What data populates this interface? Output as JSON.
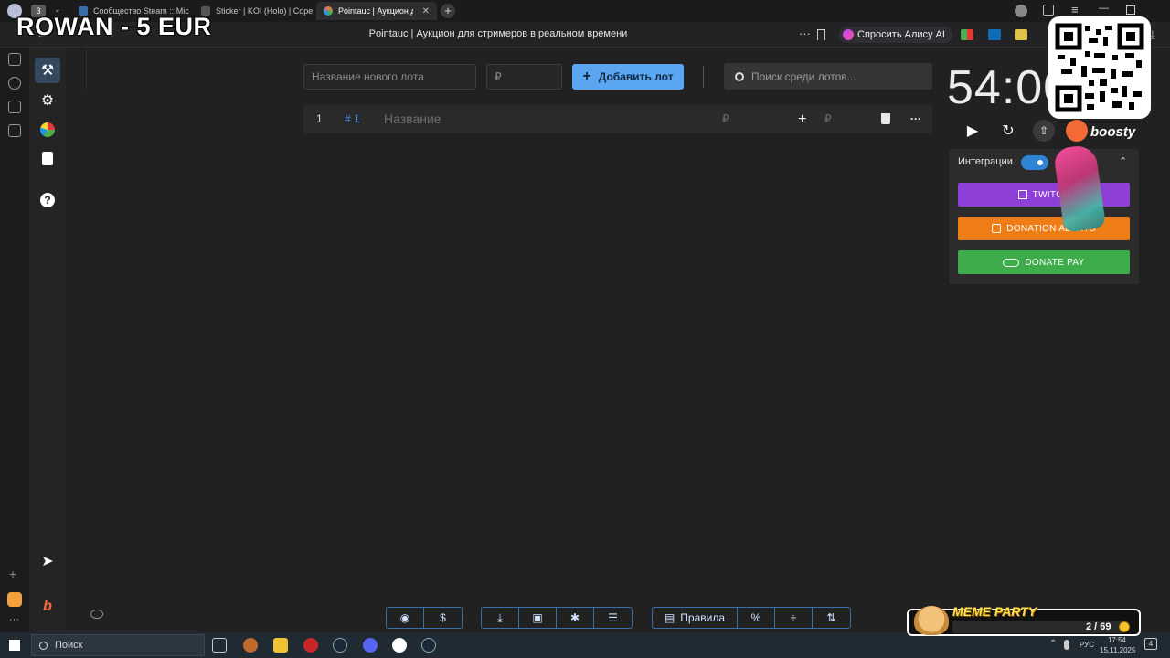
{
  "browser": {
    "tab_count": "3",
    "tabs": [
      {
        "title": "Сообщество Steam :: Mic",
        "favicon_color": "#1b2838"
      },
      {
        "title": "Sticker | KOI (Holo) | Copei",
        "favicon_color": "#333333"
      },
      {
        "title": "Pointauc | Аукцион для",
        "favicon_color": "#ff7043",
        "active": true
      }
    ],
    "page_title": "Pointauc | Аукцион для стримеров в реальном времени",
    "alisa_label": "Спросить Алису AI",
    "url_partial": "pointauc.com"
  },
  "sidebar": {
    "items": [
      {
        "icon": "gavel-icon",
        "active": true
      },
      {
        "icon": "gear-icon"
      },
      {
        "icon": "pie-chart-icon"
      },
      {
        "icon": "clipboard-icon"
      },
      {
        "icon": "help-icon"
      }
    ],
    "bottom_items": [
      {
        "icon": "telegram-icon"
      },
      {
        "icon": "boosty-icon"
      }
    ]
  },
  "lot_form": {
    "name_placeholder": "Название нового лота",
    "price_placeholder": "₽",
    "add_label": "Добавить лот",
    "search_placeholder": "Поиск среди лотов..."
  },
  "lots": [
    {
      "index": "1",
      "id": "# 1",
      "name_placeholder": "Название",
      "amount": "₽",
      "add_amount": "₽"
    }
  ],
  "timer": {
    "display": "54:00"
  },
  "integrations": {
    "label": "Интеграции",
    "enabled": true,
    "buttons": [
      {
        "label": "TWITCH",
        "color": "#8e3fd6"
      },
      {
        "label": "DONATION ALERTS",
        "color": "#ef7d16"
      },
      {
        "label": "DONATE PAY",
        "color": "#3eac4b"
      }
    ]
  },
  "bottom_toolbar": {
    "rules_label": "Правила"
  },
  "taskbar": {
    "search_label": "Поиск",
    "lang": "РУС",
    "time": "17:54",
    "date": "15.11.2025",
    "notifications": "4"
  },
  "overlays": {
    "watermark": "ROWAN - 5 EUR",
    "boosty_label": "boosty",
    "meme_title": "MEME PARTY",
    "meme_count": "2 / 69"
  }
}
